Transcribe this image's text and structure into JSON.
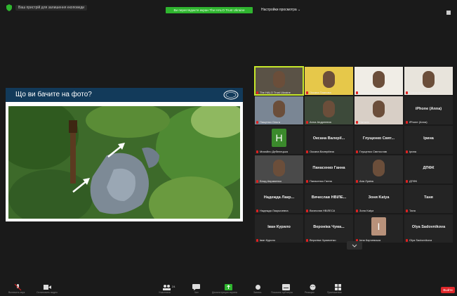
{
  "window": {
    "app_note": "Ваш пристрій для залишення екоповеди",
    "share_banner": "Ви переглядаєте екран The HALO Trust Ukraine",
    "view_settings": "Настройки просмотра ⌄"
  },
  "slide": {
    "title": "Що ви бачите на фото?"
  },
  "participants": [
    {
      "label": "The HALO Trust Ukraine",
      "type": "video",
      "active": true
    },
    {
      "label": "Оксана Павлова",
      "type": "video"
    },
    {
      "label": "Оксана Шуганова",
      "type": "video"
    },
    {
      "label": "Олеся Кучатова",
      "type": "video"
    },
    {
      "label": "Пащенко Ольга",
      "type": "video"
    },
    {
      "label": "Anna Андреевна",
      "type": "video"
    },
    {
      "label": "Наталія",
      "type": "video"
    },
    {
      "name": "iPhone (Anna)",
      "label": "iPhone (Anna)",
      "type": "name"
    },
    {
      "label": "Михайло Дебелецька",
      "type": "initial",
      "initial": "H"
    },
    {
      "name": "Оксана Валерії...",
      "label": "Оксана Валеріївна",
      "type": "name"
    },
    {
      "name": "Глущенко Свят...",
      "label": "Глущенко Святослав",
      "type": "name"
    },
    {
      "name": "Ірина",
      "label": "Ірина",
      "type": "name"
    },
    {
      "label": "Влад Авраменко",
      "type": "video"
    },
    {
      "name": "Панасенко Ганна",
      "label": "Панасенко Ганна",
      "type": "name"
    },
    {
      "label": "Аня Лукіна",
      "type": "video"
    },
    {
      "name": "ДПФК",
      "label": "ДПФК",
      "type": "name"
    },
    {
      "name": "Надежда Лакр...",
      "label": "Надежда Лакрычевна",
      "type": "name"
    },
    {
      "name": "Вячеслав НВІЛЕ...",
      "label": "Вячеслав НВІЛЕСА",
      "type": "name"
    },
    {
      "name": "Зоня Katya",
      "label": "Зоня Katya",
      "type": "name"
    },
    {
      "name": "Таня",
      "label": "Таня",
      "type": "name"
    },
    {
      "name": "Іван Курило",
      "label": "Іван Курило",
      "type": "name"
    },
    {
      "name": "Вероніка Чума...",
      "label": "Вероніка Чумаченко",
      "type": "name"
    },
    {
      "label": "Інна Кирчевська",
      "type": "initial",
      "initial": "І"
    },
    {
      "name": "Olya Sadovnikova",
      "label": "Olya Sadovnikova",
      "type": "name"
    }
  ],
  "colors": {
    "active_outline": "#c6e82a",
    "share_banner": "#2fb52f",
    "leave_button": "#e0282b",
    "slide_header": "#123a5a",
    "initial_avatar_green": "#3b8a2c"
  },
  "toolbar": {
    "audio_label": "Включить звук",
    "video_label": "Остановить видео",
    "participants_count": "24",
    "participants_label": "Участники",
    "chat_label": "Чат",
    "share_label": "Демонстрация экрана",
    "record_label": "Запись",
    "subtitles_label": "Показать субтитры",
    "reactions_label": "Реакции",
    "apps_label": "Приложения",
    "leave_label": "Выйти"
  }
}
